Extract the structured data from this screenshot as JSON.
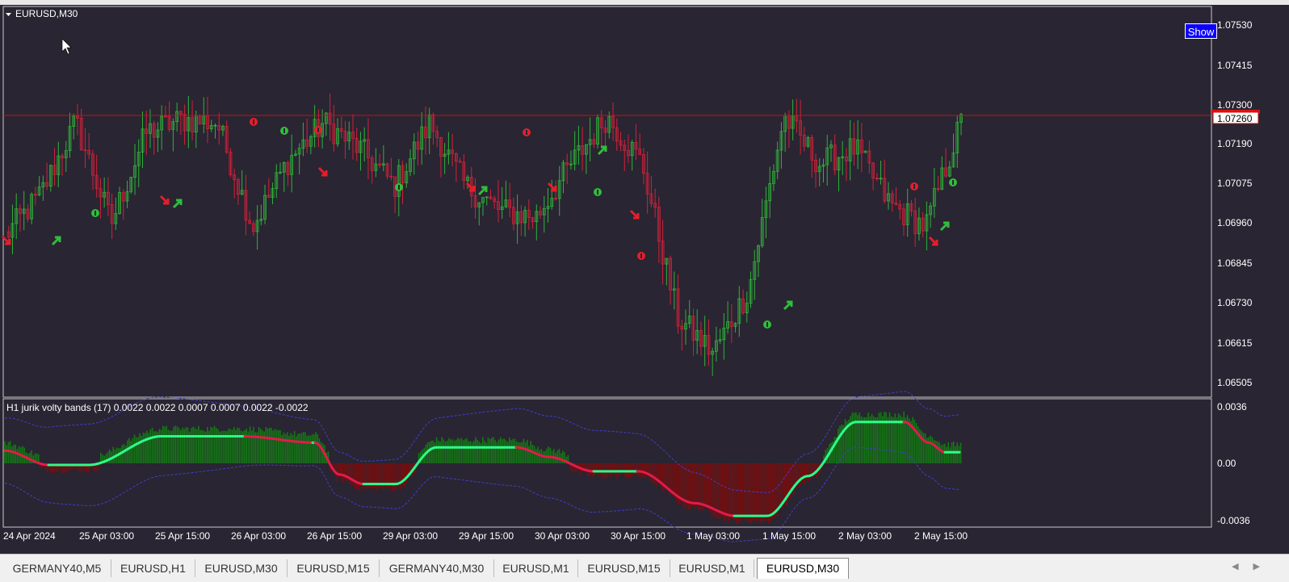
{
  "main_chart": {
    "title": "EURUSD,M30",
    "show_button": "Show",
    "price_labels": [
      "1.07530",
      "1.07415",
      "1.07300",
      "1.07190",
      "1.07075",
      "1.06960",
      "1.06845",
      "1.06730",
      "1.06615",
      "1.06505"
    ],
    "current_price": "1.07260"
  },
  "indicator": {
    "title": "H1 jurik volty bands  (17) 0.0022 0.0022 0.0007 0.0007 0.0022 -0.0022",
    "scale_labels": [
      "0.0036",
      "0.00",
      "-0.0036"
    ]
  },
  "time_axis": [
    "24 Apr 2024",
    "25 Apr 03:00",
    "25 Apr 15:00",
    "26 Apr 03:00",
    "26 Apr 15:00",
    "29 Apr 03:00",
    "29 Apr 15:00",
    "30 Apr 03:00",
    "30 Apr 15:00",
    "1 May 03:00",
    "1 May 15:00",
    "2 May 03:00",
    "2 May 15:00"
  ],
  "tabs": [
    {
      "label": "GERMANY40,M5",
      "active": false
    },
    {
      "label": "EURUSD,H1",
      "active": false
    },
    {
      "label": "EURUSD,M30",
      "active": false
    },
    {
      "label": "EURUSD,M15",
      "active": false
    },
    {
      "label": "GERMANY40,M30",
      "active": false
    },
    {
      "label": "EURUSD,M1",
      "active": false
    },
    {
      "label": "EURUSD,M15",
      "active": false
    },
    {
      "label": "EURUSD,M1",
      "active": false
    },
    {
      "label": "EURUSD,M30",
      "active": true
    }
  ],
  "colors": {
    "background": "#292532",
    "bull_candle": "#2fb33a",
    "bear_candle": "#d3213a",
    "price_line": "#c41212",
    "histogram_up": "#137a13",
    "histogram_down": "#7a0d0d",
    "jurik_up": "#2dfa8c",
    "jurik_down": "#e01b4c",
    "bands": "#3f3fd0"
  },
  "chart_data": {
    "type": "candlestick",
    "symbol": "EURUSD",
    "timeframe": "M30",
    "price_range": [
      1.0645,
      1.0759
    ],
    "current_price": 1.0726,
    "x": [
      "24 Apr 2024",
      "25 Apr 03:00",
      "25 Apr 15:00",
      "26 Apr 03:00",
      "26 Apr 15:00",
      "29 Apr 03:00",
      "29 Apr 15:00",
      "30 Apr 03:00",
      "30 Apr 15:00",
      "1 May 03:00",
      "1 May 15:00",
      "2 May 03:00",
      "2 May 15:00"
    ],
    "close_path": [
      1.0692,
      1.0705,
      1.0728,
      1.0696,
      1.0725,
      1.0729,
      1.0728,
      1.0695,
      1.0716,
      1.0728,
      1.072,
      1.0708,
      1.0728,
      1.0708,
      1.07,
      1.0698,
      1.0715,
      1.073,
      1.0715,
      1.0666,
      1.0655,
      1.0675,
      1.073,
      1.0715,
      1.072,
      1.0702,
      1.0695,
      1.0728
    ],
    "indicator": {
      "name": "H1 jurik volty bands",
      "period": 17,
      "range": [
        -0.0036,
        0.0036
      ]
    }
  }
}
